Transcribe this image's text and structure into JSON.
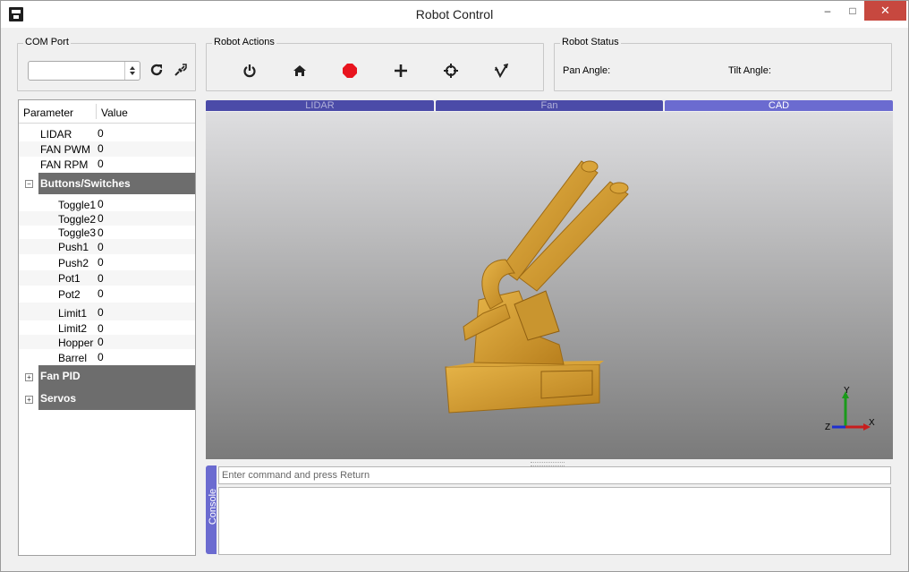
{
  "window": {
    "title": "Robot Control",
    "minimize": "–",
    "maximize": "□",
    "close": "✕"
  },
  "com_port": {
    "title": "COM Port",
    "selected": ""
  },
  "actions": {
    "title": "Robot Actions",
    "icons": [
      "power-icon",
      "home-icon",
      "stop-icon",
      "plus-icon",
      "crosshair-icon",
      "vector-icon"
    ]
  },
  "status": {
    "title": "Robot Status",
    "pan": "Pan Angle:",
    "tilt": "Tilt Angle:"
  },
  "params": {
    "col_param": "Parameter",
    "col_value": "Value",
    "top": [
      {
        "name": "LIDAR",
        "value": "0"
      },
      {
        "name": "FAN PWM",
        "value": "0"
      },
      {
        "name": "FAN RPM",
        "value": "0"
      }
    ],
    "buttons_group": "Buttons/Switches",
    "buttons": [
      {
        "name": "Toggle1",
        "value": "0"
      },
      {
        "name": "Toggle2",
        "value": "0"
      },
      {
        "name": "Toggle3",
        "value": "0"
      },
      {
        "name": "Push1",
        "value": "0"
      },
      {
        "name": "Push2",
        "value": "0"
      },
      {
        "name": "Pot1",
        "value": "0"
      },
      {
        "name": "Pot2",
        "value": "0"
      },
      {
        "name": "Limit1",
        "value": "0"
      },
      {
        "name": "Limit2",
        "value": "0"
      },
      {
        "name": "Hopper",
        "value": "0"
      },
      {
        "name": "Barrel",
        "value": "0"
      }
    ],
    "fan_pid": "Fan PID",
    "servos": "Servos"
  },
  "tabs": [
    {
      "label": "LIDAR"
    },
    {
      "label": "Fan"
    },
    {
      "label": "CAD"
    }
  ],
  "axes": {
    "x": "X",
    "y": "Y",
    "z": "Z"
  },
  "console": {
    "tab": "Console",
    "placeholder": "Enter command and press Return"
  },
  "colors": {
    "accent": "#6b6bd0",
    "tab": "#4b4ba8",
    "model": "#d2a030",
    "category": "#6d6d6d"
  }
}
